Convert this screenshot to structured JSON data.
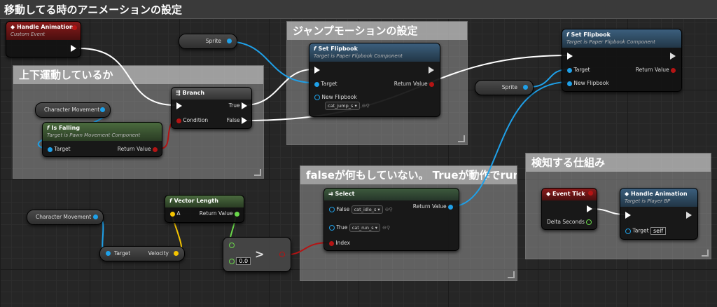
{
  "window": {
    "title": "移動してる時のアニメーションの設定"
  },
  "comments": {
    "jump": "ジャンプモーションの設定",
    "updown": "上下運動しているか",
    "select_note": "falseが何もしていない。 Trueが動作でrun",
    "detect": "検知する仕組み"
  },
  "nodes": {
    "handle_anim_event": {
      "title": "Handle Animation",
      "subtitle": "Custom Event"
    },
    "sprite_var1": {
      "label": "Sprite"
    },
    "sprite_var2": {
      "label": "Sprite"
    },
    "set_flipbook1": {
      "title": "Set Flipbook",
      "subtitle": "Target is Paper Flipbook Component",
      "target": "Target",
      "return_value": "Return Value",
      "new_flipbook": "New Flipbook",
      "flipbook_value": "cat_jump_s"
    },
    "set_flipbook2": {
      "title": "Set Flipbook",
      "subtitle": "Target is Paper Flipbook Component",
      "target": "Target",
      "return_value": "Return Value",
      "new_flipbook": "New Flipbook"
    },
    "branch": {
      "title": "Branch",
      "true": "True",
      "false": "False",
      "condition": "Condition"
    },
    "char_move1": {
      "label": "Character Movement"
    },
    "char_move2": {
      "label": "Character Movement"
    },
    "is_falling": {
      "title": "Is Falling",
      "subtitle": "Target is Pawn Movement Component",
      "target": "Target",
      "return_value": "Return Value"
    },
    "vector_length": {
      "title": "Vector Length",
      "a": "A",
      "return_value": "Return Value"
    },
    "velocity_getter": {
      "target": "Target",
      "velocity": "Velocity"
    },
    "greater": {
      "op": ">",
      "value": "0.0"
    },
    "select": {
      "title": "Select",
      "false": "False",
      "false_value": "cat_idle_s",
      "true": "True",
      "true_value": "cat_run_s",
      "index": "Index",
      "return_value": "Return Value"
    },
    "event_tick": {
      "title": "Event Tick",
      "delta": "Delta Seconds"
    },
    "handle_anim_call": {
      "title": "Handle Animation",
      "subtitle": "Target is Player BP",
      "target": "Target",
      "self_value": "self"
    }
  },
  "colors": {
    "exec": "#ffffff",
    "object": "#1fa0e8",
    "bool": "#b41414",
    "float": "#6ad84a",
    "vector": "#f5c400",
    "event_header": "#8a1b1b",
    "function_header": "#3c5f7d",
    "pure_header": "#4a6a3e"
  }
}
